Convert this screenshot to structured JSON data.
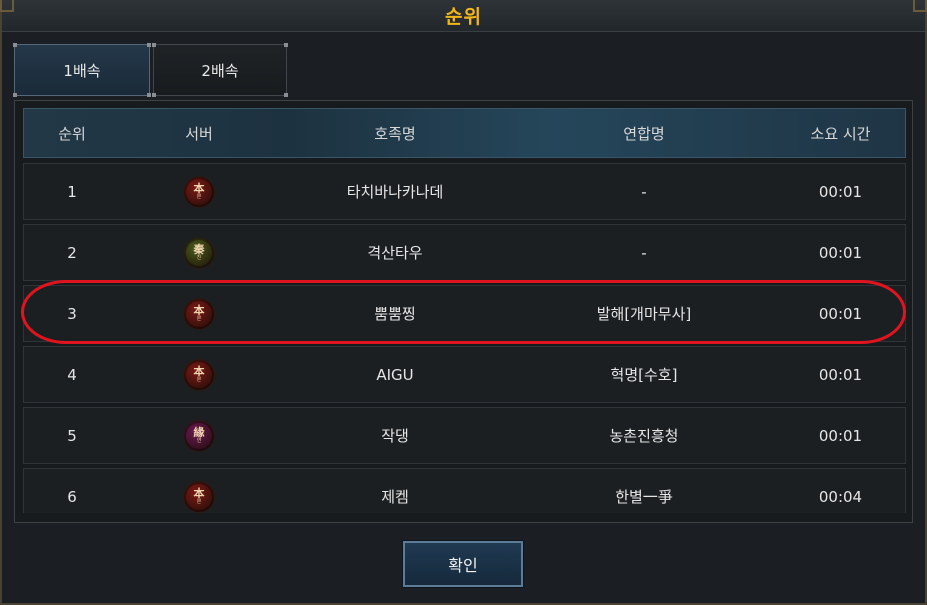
{
  "window": {
    "title": "순위"
  },
  "tabs": [
    {
      "label": "1배속",
      "active": true
    },
    {
      "label": "2배속",
      "active": false
    }
  ],
  "table": {
    "headers": {
      "rank": "순위",
      "server": "서버",
      "name": "호족명",
      "guild": "연합명",
      "time": "소요 시간"
    },
    "rows": [
      {
        "rank": "1",
        "server_icon": "server-crest-bon",
        "server_glyph": "本",
        "server_sub": "본",
        "server_color": "#7a1a14",
        "name": "타치바나카나데",
        "guild": "-",
        "time": "00:01"
      },
      {
        "rank": "2",
        "server_icon": "server-crest-jin",
        "server_glyph": "秦",
        "server_sub": "진",
        "server_color": "#4a5a1c",
        "name": "격산타우",
        "guild": "-",
        "time": "00:01"
      },
      {
        "rank": "3",
        "server_icon": "server-crest-bon",
        "server_glyph": "本",
        "server_sub": "본",
        "server_color": "#7a1a14",
        "name": "뿜뿜찡",
        "guild": "발해[개마무사]",
        "time": "00:01"
      },
      {
        "rank": "4",
        "server_icon": "server-crest-bon",
        "server_glyph": "本",
        "server_sub": "본",
        "server_color": "#7a1a14",
        "name": "AIGU",
        "guild": "혁명[수호]",
        "time": "00:01"
      },
      {
        "rank": "5",
        "server_icon": "server-crest-yeon",
        "server_glyph": "緣",
        "server_sub": "연",
        "server_color": "#6a1a4e",
        "name": "작댕",
        "guild": "농촌진흥청",
        "time": "00:01"
      },
      {
        "rank": "6",
        "server_icon": "server-crest-bon",
        "server_glyph": "本",
        "server_sub": "본",
        "server_color": "#7a1a14",
        "name": "제켐",
        "guild": "한별一爭",
        "time": "00:04"
      }
    ]
  },
  "highlighted_row": 3,
  "highlight_color": "#e0141e",
  "title_color": "#f3b617",
  "confirm_label": "확인"
}
